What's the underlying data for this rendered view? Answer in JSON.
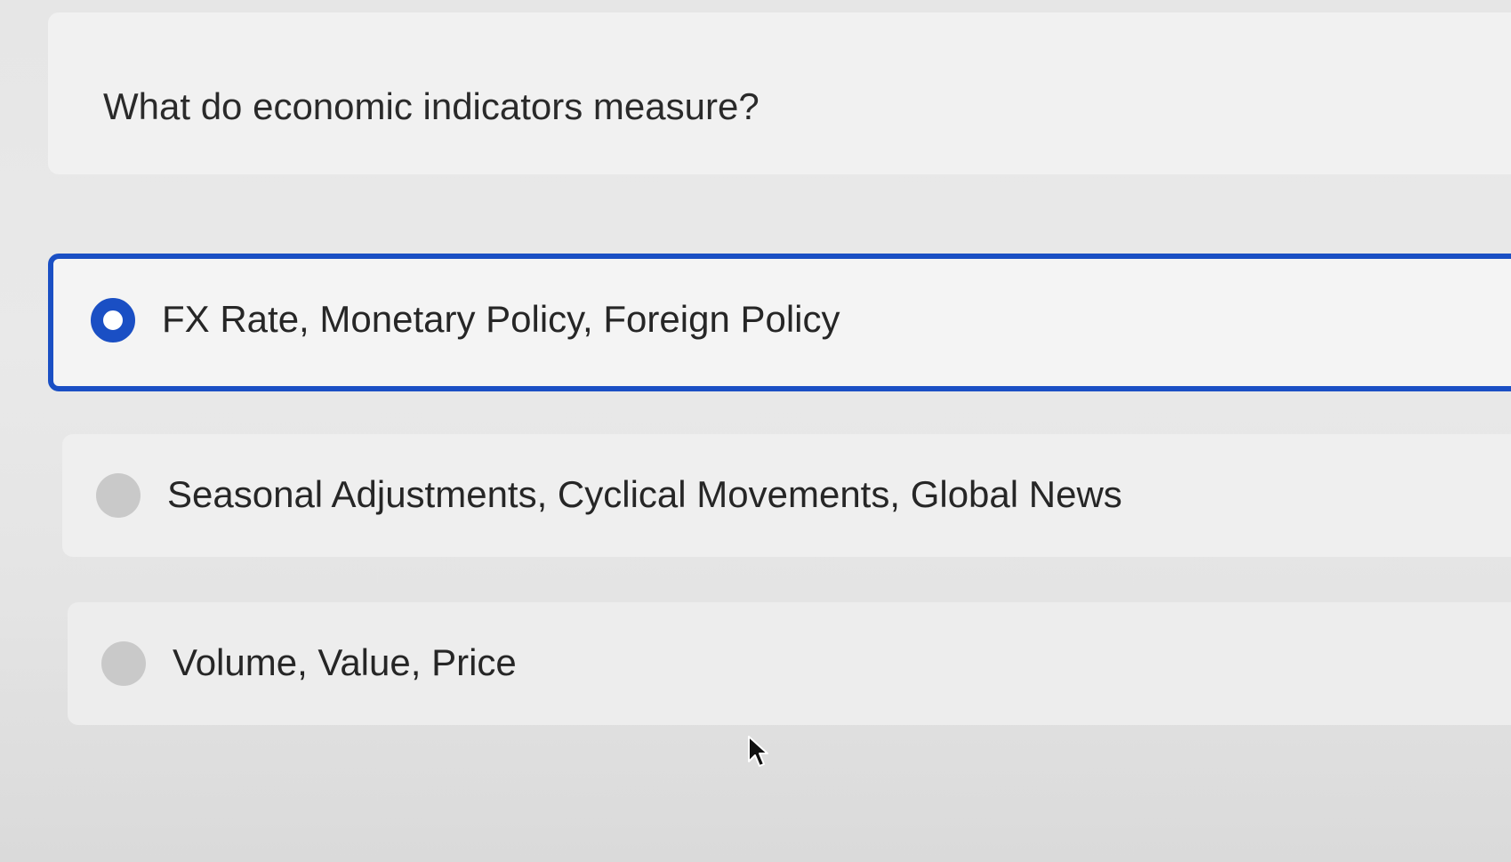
{
  "question": {
    "text": "What do economic indicators measure?"
  },
  "options": [
    {
      "label": "FX Rate, Monetary Policy, Foreign Policy",
      "selected": true
    },
    {
      "label": "Seasonal Adjustments, Cyclical Movements, Global News",
      "selected": false
    },
    {
      "label": "Volume, Value, Price",
      "selected": false
    }
  ],
  "colors": {
    "accent": "#1a4fc4",
    "radio_unselected": "#c9c9c9"
  },
  "icons": {
    "cursor": "mouse-pointer-icon"
  }
}
